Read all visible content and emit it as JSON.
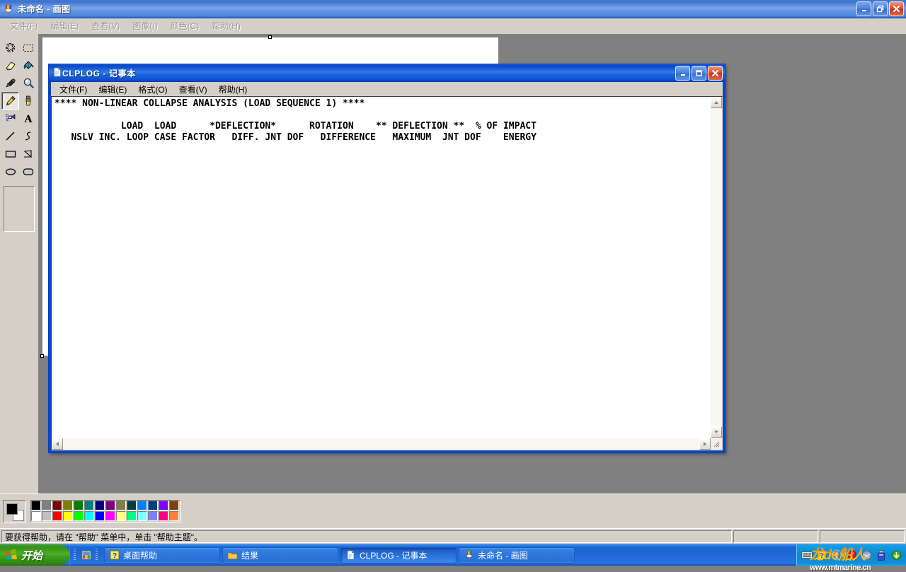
{
  "paint": {
    "title": "未命名 - 画图",
    "icon": "paint-palette-icon",
    "menu": [
      "文件(F)",
      "编辑(E)",
      "查看(V)",
      "图像(I)",
      "颜色(C)",
      "帮助(H)"
    ],
    "window_buttons": {
      "minimize": "最小化",
      "restore": "向下还原",
      "close": "关闭"
    },
    "tools": [
      {
        "name": "free-form-select-tool",
        "selected": false
      },
      {
        "name": "rectangle-select-tool",
        "selected": false
      },
      {
        "name": "eraser-tool",
        "selected": false
      },
      {
        "name": "fill-with-color-tool",
        "selected": false
      },
      {
        "name": "pick-color-tool",
        "selected": false
      },
      {
        "name": "magnifier-tool",
        "selected": false
      },
      {
        "name": "pencil-tool",
        "selected": true
      },
      {
        "name": "brush-tool",
        "selected": false
      },
      {
        "name": "airbrush-tool",
        "selected": false
      },
      {
        "name": "text-tool",
        "selected": false
      },
      {
        "name": "line-tool",
        "selected": false
      },
      {
        "name": "curve-tool",
        "selected": false
      },
      {
        "name": "rectangle-tool",
        "selected": false
      },
      {
        "name": "polygon-tool",
        "selected": false
      },
      {
        "name": "ellipse-tool",
        "selected": false
      },
      {
        "name": "rounded-rectangle-tool",
        "selected": false
      }
    ],
    "colors": {
      "foreground": "#000000",
      "background": "#ffffff",
      "palette_row1": [
        "#000000",
        "#808080",
        "#800000",
        "#808000",
        "#008000",
        "#008080",
        "#000080",
        "#800080",
        "#808040",
        "#004040",
        "#0080ff",
        "#004080",
        "#8000ff",
        "#804000"
      ],
      "palette_row2": [
        "#ffffff",
        "#c0c0c0",
        "#ff0000",
        "#ffff00",
        "#00ff00",
        "#00ffff",
        "#0000ff",
        "#ff00ff",
        "#ffff80",
        "#00ff80",
        "#80ffff",
        "#8080ff",
        "#ff0080",
        "#ff8040"
      ]
    },
    "statusbar": {
      "hint": "要获得帮助，请在 \"帮助\" 菜单中，单击 \"帮助主题\"。",
      "panel2": "",
      "panel3": ""
    }
  },
  "notepad": {
    "title": "CLPLOG - 记事本",
    "icon": "notepad-document-icon",
    "menu": [
      "文件(F)",
      "编辑(E)",
      "格式(O)",
      "查看(V)",
      "帮助(H)"
    ],
    "window_buttons": {
      "minimize": "最小化",
      "maximize": "最大化",
      "close": "关闭"
    },
    "content": "**** NON-LINEAR COLLAPSE ANALYSIS (LOAD SEQUENCE 1) ****\n\n            LOAD  LOAD      *DEFLECTION*      ROTATION    ** DEFLECTION **  % OF IMPACT\n   NSLV INC. LOOP CASE FACTOR   DIFF. JNT DOF   DIFFERENCE   MAXIMUM  JNT DOF    ENERGY",
    "scrollbars": {
      "up_arrow": "▲",
      "down_arrow": "▼",
      "left_arrow": "◄",
      "right_arrow": "►"
    }
  },
  "taskbar": {
    "start_label": "开始",
    "start_icon": "windows-flag-icon",
    "quicklaunch": [
      {
        "name": "quicklaunch-paint-icon",
        "label": "画图"
      }
    ],
    "tasks": [
      {
        "label": "桌面帮助",
        "icon": "help-question-icon",
        "active": false
      },
      {
        "label": "结果",
        "icon": "folder-icon",
        "active": false
      },
      {
        "label": "CLPLOG - 记事本",
        "icon": "notepad-document-icon",
        "active": true
      },
      {
        "label": "未命名 - 画图",
        "icon": "paint-palette-icon",
        "active": false
      }
    ],
    "tray": [
      {
        "name": "keyboard-language-icon"
      },
      {
        "name": "help-question-icon"
      },
      {
        "name": "show-hidden-icons-chevron"
      },
      {
        "name": "security-shield-icon"
      },
      {
        "name": "network-activity-icon"
      },
      {
        "name": "usb-device-icon"
      },
      {
        "name": "update-arrow-icon"
      }
    ],
    "watermark": {
      "line1": "龙de船人",
      "line2": "www.mtmarine.cn"
    }
  }
}
